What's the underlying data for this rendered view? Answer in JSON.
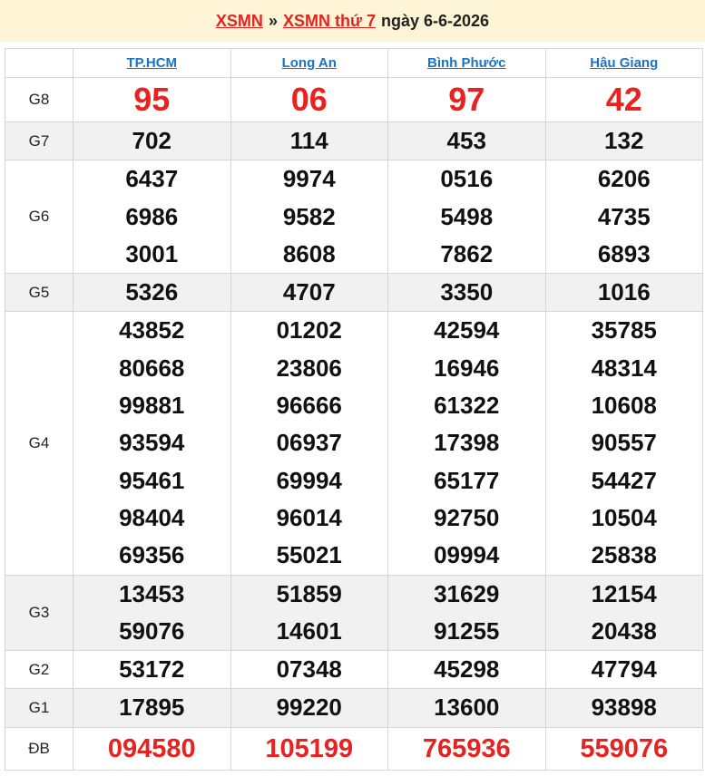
{
  "header": {
    "link_region": "XSMN",
    "separator": "»",
    "link_day": "XSMN thứ 7",
    "date_text": "ngày 6-6-2026"
  },
  "colors": {
    "accent_red": "#e8221f",
    "link_blue": "#1a73c4",
    "header_bg": "#fdf5d5",
    "row_shade": "#f1f1f1"
  },
  "provinces": [
    "TP.HCM",
    "Long An",
    "Bình Phước",
    "Hậu Giang"
  ],
  "prizes": [
    {
      "label": "G8",
      "style": "big-red",
      "shaded": false,
      "values": [
        [
          "95"
        ],
        [
          "06"
        ],
        [
          "97"
        ],
        [
          "42"
        ]
      ]
    },
    {
      "label": "G7",
      "style": "normal",
      "shaded": true,
      "values": [
        [
          "702"
        ],
        [
          "114"
        ],
        [
          "453"
        ],
        [
          "132"
        ]
      ]
    },
    {
      "label": "G6",
      "style": "normal",
      "shaded": false,
      "values": [
        [
          "6437",
          "6986",
          "3001"
        ],
        [
          "9974",
          "9582",
          "8608"
        ],
        [
          "0516",
          "5498",
          "7862"
        ],
        [
          "6206",
          "4735",
          "6893"
        ]
      ]
    },
    {
      "label": "G5",
      "style": "normal",
      "shaded": true,
      "values": [
        [
          "5326"
        ],
        [
          "4707"
        ],
        [
          "3350"
        ],
        [
          "1016"
        ]
      ]
    },
    {
      "label": "G4",
      "style": "normal",
      "shaded": false,
      "values": [
        [
          "43852",
          "80668",
          "99881",
          "93594",
          "95461",
          "98404",
          "69356"
        ],
        [
          "01202",
          "23806",
          "96666",
          "06937",
          "69994",
          "96014",
          "55021"
        ],
        [
          "42594",
          "16946",
          "61322",
          "17398",
          "65177",
          "92750",
          "09994"
        ],
        [
          "35785",
          "48314",
          "10608",
          "90557",
          "54427",
          "10504",
          "25838"
        ]
      ]
    },
    {
      "label": "G3",
      "style": "normal",
      "shaded": true,
      "values": [
        [
          "13453",
          "59076"
        ],
        [
          "51859",
          "14601"
        ],
        [
          "31629",
          "91255"
        ],
        [
          "12154",
          "20438"
        ]
      ]
    },
    {
      "label": "G2",
      "style": "normal",
      "shaded": false,
      "values": [
        [
          "53172"
        ],
        [
          "07348"
        ],
        [
          "45298"
        ],
        [
          "47794"
        ]
      ]
    },
    {
      "label": "G1",
      "style": "normal",
      "shaded": true,
      "values": [
        [
          "17895"
        ],
        [
          "99220"
        ],
        [
          "13600"
        ],
        [
          "93898"
        ]
      ]
    },
    {
      "label": "ĐB",
      "style": "special",
      "shaded": false,
      "values": [
        [
          "094580"
        ],
        [
          "105199"
        ],
        [
          "765936"
        ],
        [
          "559076"
        ]
      ]
    }
  ]
}
